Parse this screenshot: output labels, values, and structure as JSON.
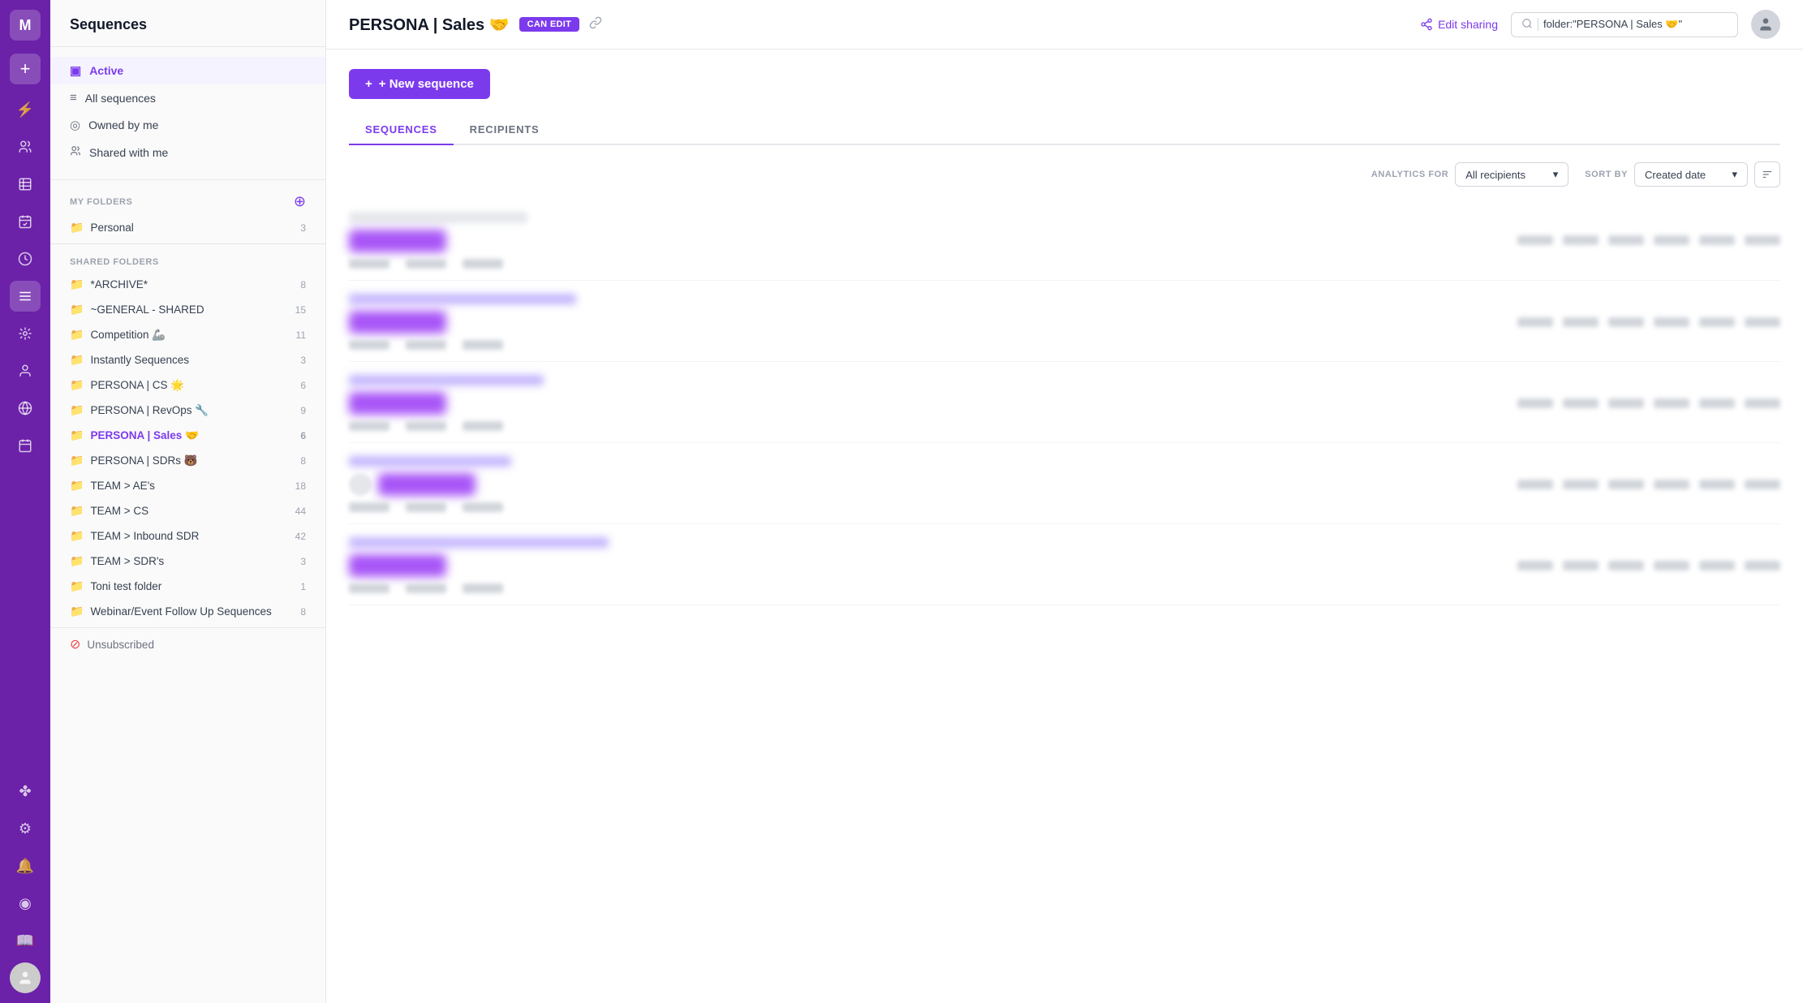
{
  "app": {
    "logo": "M",
    "title": "Sequences"
  },
  "rail": {
    "icons": [
      {
        "name": "add-icon",
        "symbol": "+",
        "active": false
      },
      {
        "name": "lightning-icon",
        "symbol": "⚡",
        "active": false
      },
      {
        "name": "people-icon",
        "symbol": "⑂",
        "active": false
      },
      {
        "name": "chart-icon",
        "symbol": "▤",
        "active": false
      },
      {
        "name": "tasks-icon",
        "symbol": "☑",
        "active": false
      },
      {
        "name": "clock-icon",
        "symbol": "◷",
        "active": false
      },
      {
        "name": "sequences-icon",
        "symbol": "≡",
        "active": true
      },
      {
        "name": "connections-icon",
        "symbol": "⊙",
        "active": false
      },
      {
        "name": "contacts-icon",
        "symbol": "👤",
        "active": false
      },
      {
        "name": "globe-icon",
        "symbol": "⊕",
        "active": false
      },
      {
        "name": "calendar-icon",
        "symbol": "▦",
        "active": false
      }
    ],
    "bottom_icons": [
      {
        "name": "automation-icon",
        "symbol": "✤"
      },
      {
        "name": "settings-icon",
        "symbol": "⚙"
      },
      {
        "name": "bell-icon",
        "symbol": "🔔"
      },
      {
        "name": "circle-icon",
        "symbol": "◉"
      },
      {
        "name": "book-icon",
        "symbol": "📖"
      }
    ]
  },
  "sidebar": {
    "title": "Sequences",
    "nav_items": [
      {
        "name": "active",
        "label": "Active",
        "icon": "▣",
        "active": true
      },
      {
        "name": "all-sequences",
        "label": "All sequences",
        "icon": "≡"
      },
      {
        "name": "owned-by-me",
        "label": "Owned by me",
        "icon": "◎"
      },
      {
        "name": "shared-with-me",
        "label": "Shared with me",
        "icon": "⑂"
      }
    ],
    "my_folders": {
      "label": "MY FOLDERS",
      "items": [
        {
          "name": "personal",
          "label": "Personal",
          "count": "3"
        }
      ]
    },
    "shared_folders": {
      "label": "SHARED FOLDERS",
      "items": [
        {
          "name": "archive",
          "label": "*ARCHIVE*",
          "count": "8"
        },
        {
          "name": "general-shared",
          "label": "~GENERAL - SHARED",
          "count": "15"
        },
        {
          "name": "competition",
          "label": "Competition 🦾",
          "count": "11"
        },
        {
          "name": "instantly-sequences",
          "label": "Instantly Sequences",
          "count": "3"
        },
        {
          "name": "persona-cs",
          "label": "PERSONA | CS 🌟",
          "count": "6"
        },
        {
          "name": "persona-revops",
          "label": "PERSONA | RevOps 🔧",
          "count": "9"
        },
        {
          "name": "persona-sales",
          "label": "PERSONA | Sales 🤝",
          "count": "6",
          "active": true
        },
        {
          "name": "persona-sdrs",
          "label": "PERSONA | SDRs 🐻",
          "count": "8"
        },
        {
          "name": "team-aes",
          "label": "TEAM > AE's",
          "count": "18"
        },
        {
          "name": "team-cs",
          "label": "TEAM > CS",
          "count": "44"
        },
        {
          "name": "team-inbound-sdr",
          "label": "TEAM > Inbound SDR",
          "count": "42"
        },
        {
          "name": "team-sdrs",
          "label": "TEAM > SDR's",
          "count": "3"
        },
        {
          "name": "toni-test-folder",
          "label": "Toni test folder",
          "count": "1"
        },
        {
          "name": "webinar-event",
          "label": "Webinar/Event Follow Up Sequences",
          "count": "8"
        }
      ]
    },
    "unsubscribed": "Unsubscribed"
  },
  "topbar": {
    "title": "PERSONA | Sales 🤝",
    "badge": "CAN EDIT",
    "edit_sharing": "Edit sharing",
    "search_value": "folder:\"PERSONA | Sales 🤝\""
  },
  "content": {
    "new_sequence_label": "+ New sequence",
    "tabs": [
      {
        "name": "sequences-tab",
        "label": "SEQUENCES",
        "active": true
      },
      {
        "name": "recipients-tab",
        "label": "RECIPIENTS",
        "active": false
      }
    ],
    "analytics_label": "ANALYTICS FOR",
    "analytics_value": "All recipients",
    "sort_label": "SORT BY",
    "sort_value": "Created date"
  }
}
